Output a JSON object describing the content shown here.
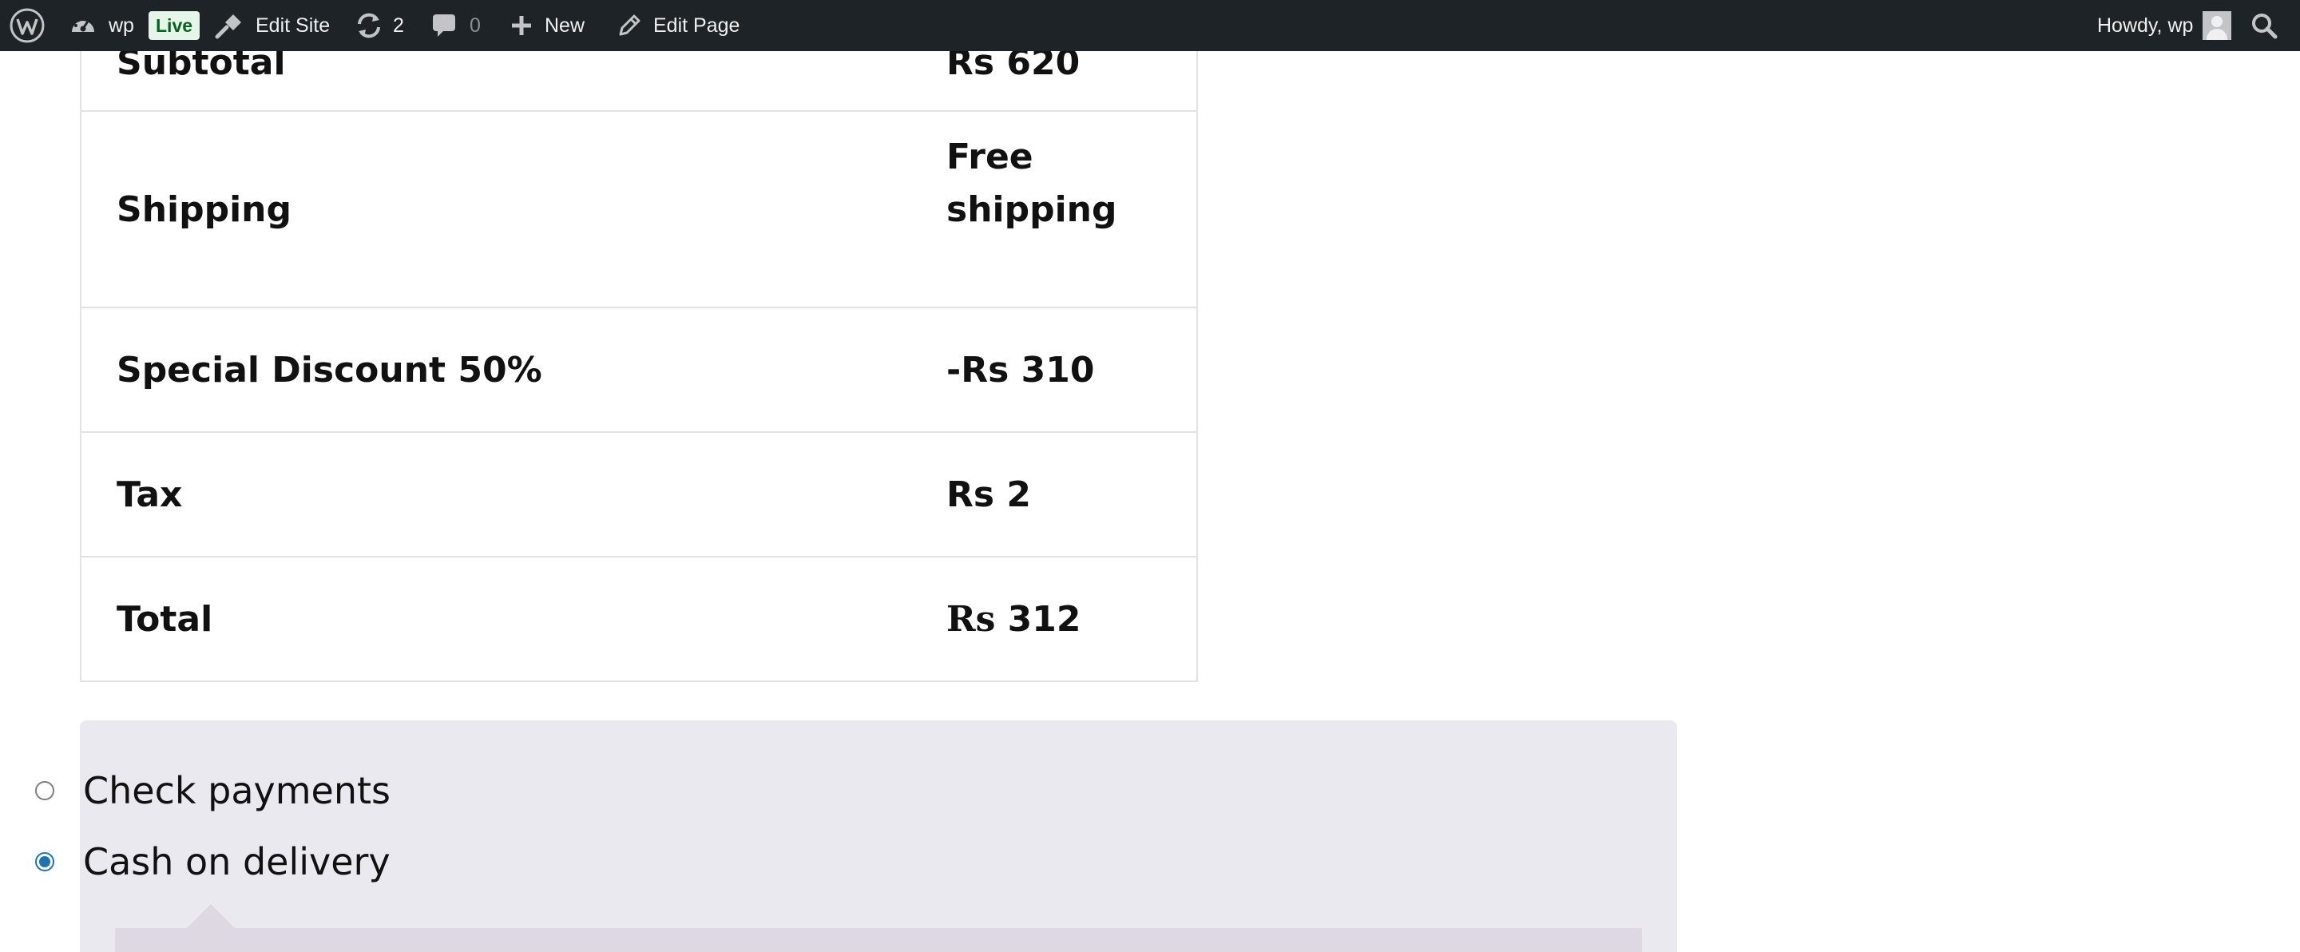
{
  "adminbar": {
    "site_name": "wp",
    "live_badge": "Live",
    "edit_site": "Edit Site",
    "updates_count": "2",
    "comments_count": "0",
    "new_label": "New",
    "edit_page": "Edit Page",
    "howdy": "Howdy, wp",
    "icons": [
      "wordpress-logo-icon",
      "dashboard-icon",
      "edit-site-icon",
      "updates-icon",
      "comments-icon",
      "plus-icon",
      "pencil-icon",
      "search-icon"
    ]
  },
  "totals": {
    "rows": [
      {
        "label": "Subtotal",
        "value": "Rs 620"
      },
      {
        "label": "Shipping",
        "value": "Free shipping"
      },
      {
        "label": "Special Discount 50%",
        "value": "-Rs 310"
      },
      {
        "label": "Tax",
        "value": "Rs 2"
      },
      {
        "label": "Total",
        "currency": "Rs",
        "amount": "312"
      }
    ]
  },
  "payment": {
    "options": [
      {
        "label": "Check payments",
        "selected": false
      },
      {
        "label": "Cash on delivery",
        "selected": true
      }
    ],
    "accent_color": "#2271b1"
  }
}
